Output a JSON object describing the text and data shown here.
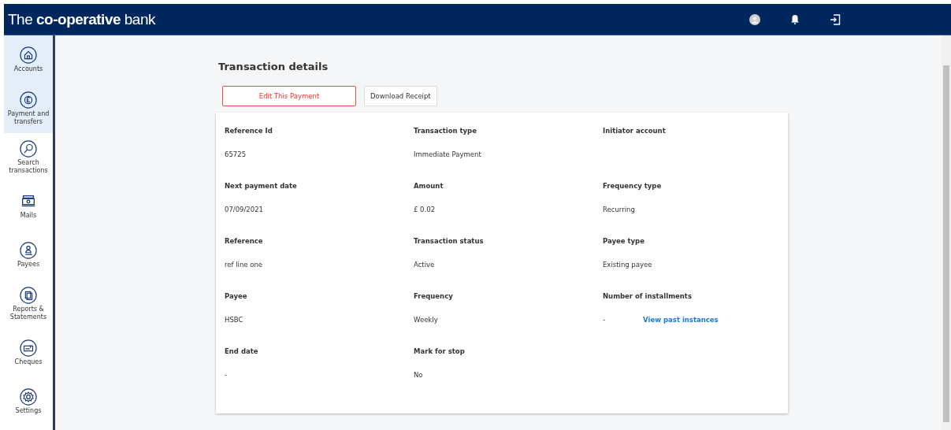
{
  "header": {
    "logo_light": "The",
    "logo_bold": "co-operative",
    "logo_end": "bank"
  },
  "sidebar": {
    "items": [
      {
        "label": "Accounts",
        "selected": true
      },
      {
        "label": "Payment and transfers",
        "selected": true
      },
      {
        "label": "Search transactions",
        "selected": false
      },
      {
        "label": "Mails",
        "selected": false
      },
      {
        "label": "Payees",
        "selected": false
      },
      {
        "label": "Reports & Statements",
        "selected": false
      },
      {
        "label": "Cheques",
        "selected": false
      },
      {
        "label": "Settings",
        "selected": false
      }
    ]
  },
  "page": {
    "title": "Transaction details",
    "buttons": [
      {
        "label": "Edit This Payment",
        "kind": "outline"
      },
      {
        "label": "Download Receipt",
        "kind": "plain"
      }
    ]
  },
  "details": [
    {
      "label": "Reference Id",
      "value": "65725"
    },
    {
      "label": "Transaction type",
      "value": "Immediate Payment"
    },
    {
      "label": "Initiator account"
    },
    {
      "label": "Next payment date",
      "value": "07/09/2021"
    },
    {
      "label": "Amount",
      "value": "£ 0.02"
    },
    {
      "label": "Frequency type",
      "value": "Recurring"
    },
    {
      "label": "Reference",
      "value": "ref line one"
    },
    {
      "label": "Transaction status",
      "value": "Active"
    },
    {
      "label": "Payee type",
      "value": "Existing payee"
    },
    {
      "label": "Payee",
      "value": "HSBC"
    },
    {
      "label": "Frequency",
      "value": "Weekly"
    },
    {
      "label": "Number of installments",
      "value": "-",
      "link": "View past instances"
    },
    {
      "label": "End date",
      "value": "-"
    },
    {
      "label": "Mark for stop",
      "value": "No"
    }
  ]
}
